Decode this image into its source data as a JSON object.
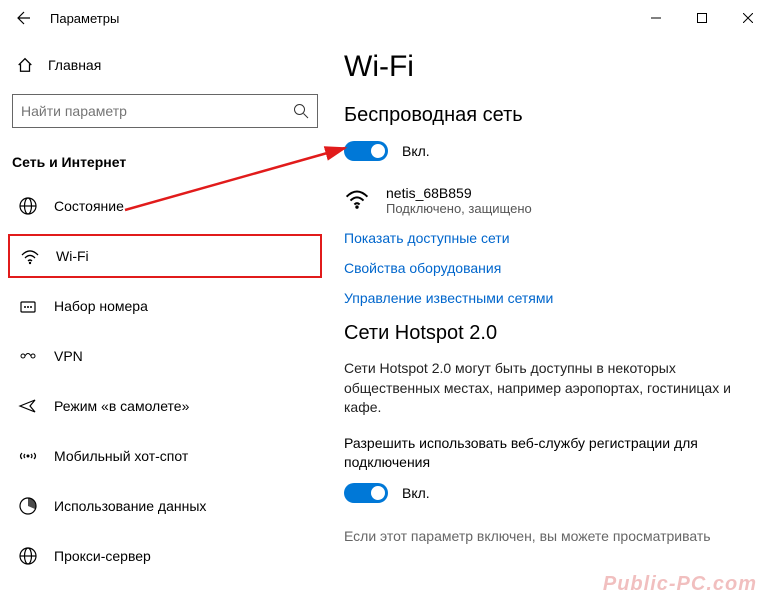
{
  "titlebar": {
    "title": "Параметры"
  },
  "home": {
    "label": "Главная"
  },
  "search": {
    "placeholder": "Найти параметр"
  },
  "category": "Сеть и Интернет",
  "nav": [
    {
      "label": "Состояние"
    },
    {
      "label": "Wi-Fi"
    },
    {
      "label": "Набор номера"
    },
    {
      "label": "VPN"
    },
    {
      "label": "Режим «в самолете»"
    },
    {
      "label": "Мобильный хот-спот"
    },
    {
      "label": "Использование данных"
    },
    {
      "label": "Прокси-сервер"
    }
  ],
  "main": {
    "heading": "Wi-Fi",
    "sub1": "Беспроводная сеть",
    "toggle1_label": "Вкл.",
    "network_name": "netis_68B859",
    "network_status": "Подключено, защищено",
    "link1": "Показать доступные сети",
    "link2": "Свойства оборудования",
    "link3": "Управление известными сетями",
    "sub2": "Сети Hotspot 2.0",
    "para1": "Сети Hotspot 2.0 могут быть доступны в некоторых общественных местах, например аэропортах, гостиницах и кафе.",
    "label2": "Разрешить использовать веб-службу регистрации для подключения",
    "toggle2_label": "Вкл.",
    "para2": "Если этот параметр включен, вы можете просматривать"
  },
  "watermark": "Public-PC.com"
}
